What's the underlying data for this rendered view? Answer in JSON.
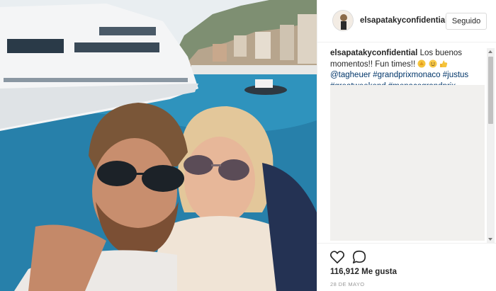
{
  "post": {
    "username": "elsapatakyconfidential",
    "follow_label": "Seguido",
    "caption_text": "Los buenos momentos!! Fun times!!",
    "hashtags": [
      "@tagheuer",
      "#grandprixmonaco",
      "#justus",
      "#greatweekend",
      "#monacograndprix"
    ],
    "caption_emojis": [
      "clapping-hands-emoji",
      "smiling-face-emoji",
      "thumbs-up-emoji"
    ],
    "likes_count": "116,912",
    "likes_label": "Me gusta",
    "date": "28 DE MAYO"
  },
  "colors": {
    "link": "#003569",
    "border": "#efefef",
    "text": "#262626",
    "muted": "#999999"
  },
  "icons": {
    "like": "heart-icon",
    "comment": "speech-bubble-icon"
  }
}
